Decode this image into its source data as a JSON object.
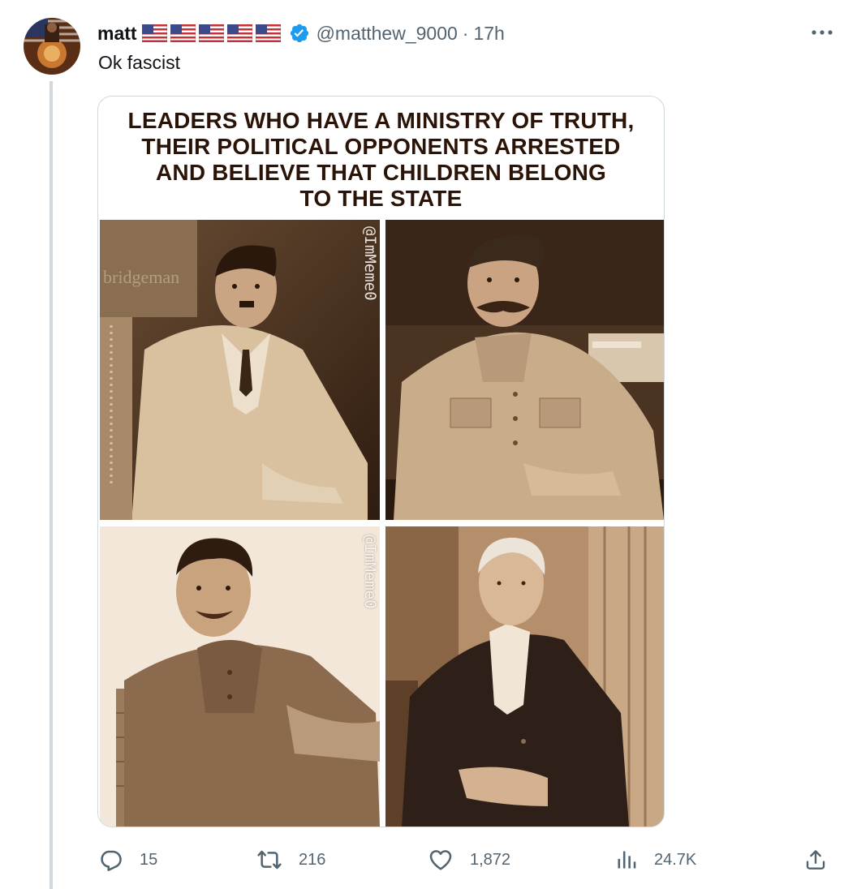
{
  "tweet": {
    "author_name": "matt",
    "flags": [
      "us-flag",
      "us-flag",
      "us-flag",
      "us-flag",
      "us-flag"
    ],
    "verified": true,
    "handle": "@matthew_9000",
    "separator": "·",
    "time": "17h",
    "text": "Ok fascist"
  },
  "media": {
    "title_lines": [
      "LEADERS WHO HAVE A MINISTRY OF TRUTH,",
      "THEIR POLITICAL OPPONENTS ARRESTED",
      "AND BELIEVE THAT CHILDREN BELONG",
      "TO THE STATE"
    ],
    "watermark": "@ImMeme0",
    "photo_stamp": "bridgeman"
  },
  "actions": {
    "reply_count": "15",
    "retweet_count": "216",
    "like_count": "1,872",
    "view_count": "24.7K"
  },
  "colors": {
    "text": "#0f1419",
    "secondary": "#536471",
    "verified_blue": "#1d9bf0",
    "thread_line": "#cfd9de",
    "sepia_dark": "#2b1407"
  },
  "icons": [
    "more-icon",
    "reply-icon",
    "retweet-icon",
    "like-icon",
    "views-icon",
    "share-icon",
    "verified-badge-icon"
  ]
}
